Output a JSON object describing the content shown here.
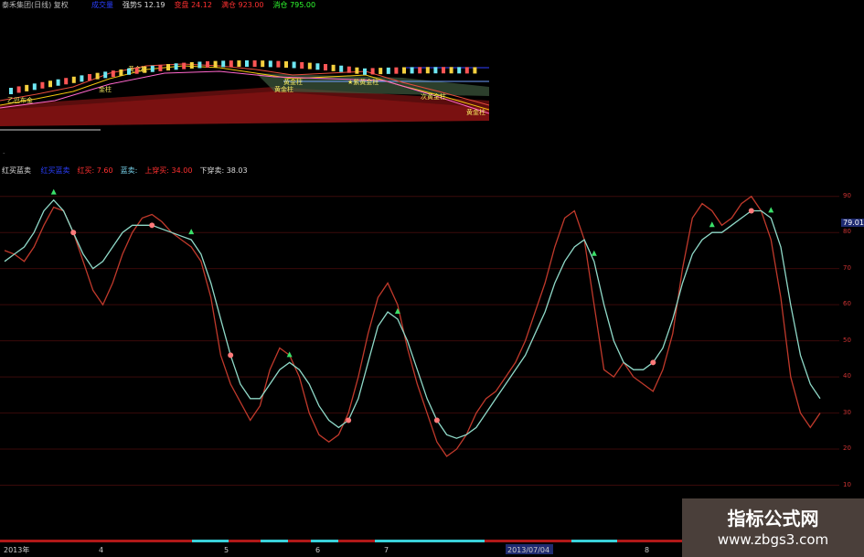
{
  "top_panel": {
    "title": "泰禾集团(日线) 复权",
    "stats": [
      {
        "label": "成交量",
        "value": "",
        "color": "#2a3fff"
      },
      {
        "label": "强势S",
        "value": "12.19",
        "color": "#dddddd"
      },
      {
        "label": "变盘",
        "value": "24.12",
        "color": "#ff3030"
      },
      {
        "label": "满仓",
        "value": "923.00",
        "color": "#ff3030"
      },
      {
        "label": "消仓",
        "value": "795.00",
        "color": "#30ff30"
      }
    ],
    "annotations": [
      "乙巴布金",
      "金柱",
      "黄金柱",
      "黄金柱",
      "黄金柱",
      "★紫黄金柱",
      "次黄金柱",
      "黄金柱"
    ],
    "context_label": "-"
  },
  "main_panel": {
    "indicator_name": "红买蓝卖",
    "legend": [
      {
        "label": "红买蓝卖",
        "value": "",
        "color": "#2a3fff"
      },
      {
        "label": "红买:",
        "value": "7.60",
        "color": "#ff3030"
      },
      {
        "label": "蓝卖:",
        "value": "",
        "color": "#7ad7f0"
      },
      {
        "label": "上穿买:",
        "value": "34.00",
        "color": "#ff3030"
      },
      {
        "label": "下穿卖:",
        "value": "38.03",
        "color": "#dddddd"
      }
    ],
    "current_value": "79.01",
    "y_ticks": [
      "90",
      "80",
      "70",
      "60",
      "50",
      "40",
      "30",
      "20",
      "10"
    ]
  },
  "xaxis": {
    "labels": [
      "2013年",
      "4",
      "5",
      "6",
      "7",
      "2013/07/04",
      "8"
    ]
  },
  "watermark": {
    "title": "指标公式网",
    "url": "www.zbgs3.com"
  },
  "chart_data": {
    "type": "line",
    "ylim": [
      0,
      95
    ],
    "series": [
      {
        "name": "红买",
        "color": "#c0392b",
        "values": [
          75,
          74,
          72,
          76,
          82,
          87,
          86,
          80,
          72,
          64,
          60,
          66,
          74,
          80,
          84,
          85,
          83,
          80,
          78,
          76,
          72,
          62,
          46,
          38,
          33,
          28,
          32,
          42,
          48,
          46,
          40,
          30,
          24,
          22,
          24,
          30,
          40,
          52,
          62,
          66,
          60,
          48,
          38,
          30,
          22,
          18,
          20,
          24,
          30,
          34,
          36,
          40,
          44,
          50,
          58,
          66,
          76,
          84,
          86,
          78,
          60,
          42,
          40,
          44,
          40,
          38,
          36,
          42,
          52,
          70,
          84,
          88,
          86,
          82,
          84,
          88,
          90,
          86,
          78,
          62,
          40,
          30,
          26,
          30
        ]
      },
      {
        "name": "蓝卖",
        "color": "#8fd9c8",
        "values": [
          72,
          74,
          76,
          80,
          86,
          89,
          86,
          80,
          74,
          70,
          72,
          76,
          80,
          82,
          82,
          82,
          81,
          80,
          79,
          78,
          74,
          66,
          56,
          46,
          38,
          34,
          34,
          38,
          42,
          44,
          42,
          38,
          32,
          28,
          26,
          28,
          34,
          44,
          54,
          58,
          56,
          50,
          42,
          34,
          28,
          24,
          23,
          24,
          26,
          30,
          34,
          38,
          42,
          46,
          52,
          58,
          66,
          72,
          76,
          78,
          72,
          60,
          50,
          44,
          42,
          42,
          44,
          48,
          56,
          66,
          74,
          78,
          80,
          80,
          82,
          84,
          86,
          86,
          84,
          76,
          60,
          46,
          38,
          34
        ]
      }
    ]
  }
}
